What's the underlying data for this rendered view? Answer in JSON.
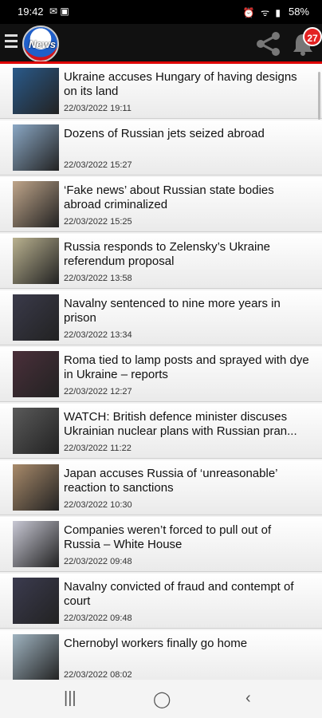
{
  "status_bar": {
    "time": "19:42",
    "battery": "58%"
  },
  "header": {
    "logo_text": "News",
    "notification_count": "27"
  },
  "articles": [
    {
      "title": "Ukraine accuses Hungary of having designs on its land",
      "date": "22/03/2022 19:11",
      "thumb_color": "#2a5a8a"
    },
    {
      "title": "Dozens of Russian jets seized abroad",
      "date": "22/03/2022 15:27",
      "thumb_color": "#8aa7c4"
    },
    {
      "title": "‘Fake news’ about Russian state bodies abroad criminalized",
      "date": "22/03/2022 15:25",
      "thumb_color": "#bfa58a"
    },
    {
      "title": "Russia responds to Zelensky’s Ukraine referendum proposal",
      "date": "22/03/2022 13:58",
      "thumb_color": "#b9b18f"
    },
    {
      "title": "Navalny sentenced to nine more years in prison",
      "date": "22/03/2022 13:34",
      "thumb_color": "#3a3a4a"
    },
    {
      "title": "Roma tied to lamp posts and sprayed with dye in Ukraine – reports",
      "date": "22/03/2022 12:27",
      "thumb_color": "#4a2f3a"
    },
    {
      "title": "WATCH: British defence minister discuses Ukrainian nuclear plans with Russian pran...",
      "date": "22/03/2022 11:22",
      "thumb_color": "#5a5a5a"
    },
    {
      "title": "Japan accuses Russia of ‘unreasonable’ reaction to sanctions",
      "date": "22/03/2022 10:30",
      "thumb_color": "#a88a6a"
    },
    {
      "title": "Companies weren’t forced to pull out of Russia – White House",
      "date": "22/03/2022 09:48",
      "thumb_color": "#c8c8d4"
    },
    {
      "title": "Navalny convicted of fraud and contempt of court",
      "date": "22/03/2022 09:48",
      "thumb_color": "#3b3b4f"
    },
    {
      "title": "Chernobyl workers finally go home",
      "date": "22/03/2022 08:02",
      "thumb_color": "#9fb3c0"
    }
  ]
}
